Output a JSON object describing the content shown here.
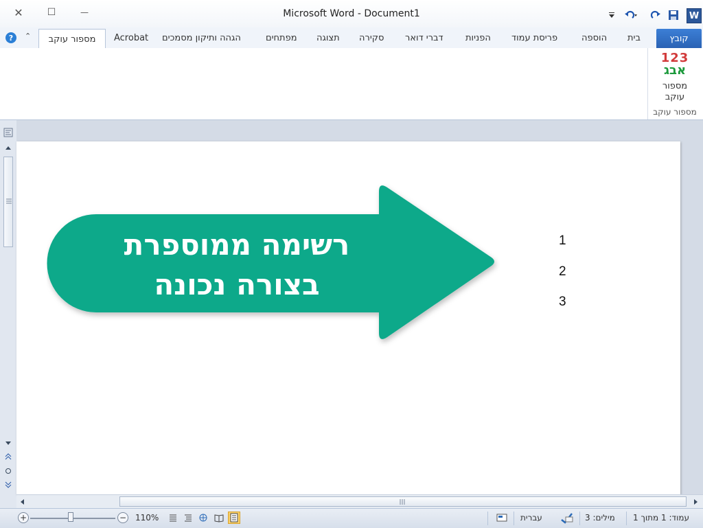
{
  "window": {
    "title": "Microsoft Word  -  Document1",
    "app_icon_letter": "W",
    "close_glyph": "✕",
    "maximize_glyph": "☐",
    "minimize_glyph": "—"
  },
  "tabs": {
    "file": "קובץ",
    "items": [
      "בית",
      "הוספה",
      "פריסת עמוד",
      "הפניות",
      "דברי דואר",
      "סקירה",
      "תצוגה",
      "מפתחים",
      "הגהה ותיקון מסמכים",
      "Acrobat"
    ],
    "active": "מספור עוקב",
    "help": "?",
    "minimize_ribbon": "⌃"
  },
  "ribbon": {
    "button_icon_top": "123",
    "button_icon_bottom": "אבג",
    "button_label_line1": "מספור",
    "button_label_line2": "עוקב",
    "group_label": "מספור עוקב"
  },
  "document": {
    "list_numbers": [
      "1",
      "2",
      "3"
    ],
    "callout_line1": "רשימה ממוספרת",
    "callout_line2": "בצורה נכונה"
  },
  "colors": {
    "callout": "#0aa98a",
    "accent": "#2b579a"
  },
  "statusbar": {
    "page": "עמוד: 1 מתוך 1",
    "words": "מילים: 3",
    "language": "עברית",
    "zoom": "110%",
    "zoom_in": "+",
    "zoom_out": "−"
  }
}
